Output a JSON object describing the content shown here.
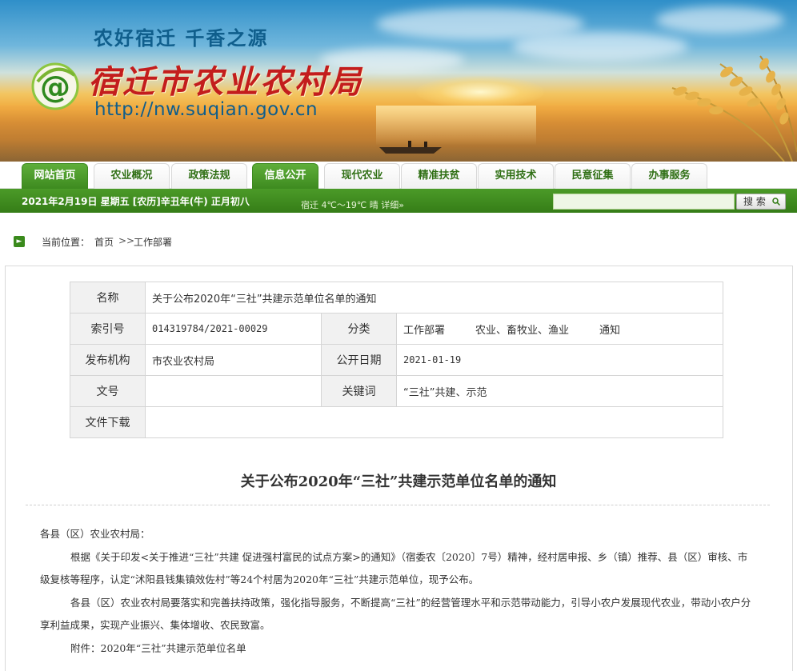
{
  "header": {
    "slogan": "农好宿迁  千香之源",
    "org_name": "宿迁市农业农村局",
    "site_url": "http://nw.suqian.gov.cn",
    "logo_text": "@"
  },
  "nav": {
    "tabs": [
      {
        "label": "网站首页",
        "active": true
      },
      {
        "label": "农业概况",
        "active": false
      },
      {
        "label": "政策法规",
        "active": false
      },
      {
        "label": "信息公开",
        "active": true
      },
      {
        "label": "现代农业",
        "active": false
      },
      {
        "label": "精准扶贫",
        "active": false
      },
      {
        "label": "实用技术",
        "active": false
      },
      {
        "label": "民意征集",
        "active": false
      },
      {
        "label": "办事服务",
        "active": false
      }
    ]
  },
  "infobar": {
    "date": "2021年2月19日 星期五 [农历]辛丑年(牛) 正月初八",
    "weather": "宿迁 4℃～19℃ 晴 详细»",
    "search_placeholder": "",
    "search_label": "搜 索"
  },
  "breadcrumb": {
    "label": "当前位置：",
    "home": "首页",
    "separator": ">>",
    "current": "工作部署"
  },
  "meta": {
    "name_key": "名称",
    "name_value": "关于公布2020年“三社”共建示范单位名单的通知",
    "index_key": "索引号",
    "index_value": "014319784/2021-00029",
    "category_key": "分类",
    "category_values": [
      "工作部署",
      "农业、畜牧业、渔业",
      "通知"
    ],
    "publisher_key": "发布机构",
    "publisher_value": "市农业农村局",
    "date_key": "公开日期",
    "date_value": "2021-01-19",
    "docno_key": "文号",
    "docno_value": "",
    "keywords_key": "关键词",
    "keywords_value": "“三社”共建、示范",
    "download_key": "文件下载",
    "download_value": ""
  },
  "article": {
    "title": "关于公布2020年“三社”共建示范单位名单的通知",
    "paragraphs": [
      "各县（区）农业农村局：",
      "根据《关于印发<关于推进“三社”共建 促进强村富民的试点方案>的通知》（宿委农〔2020〕7号）精神，经村居申报、乡（镇）推荐、县（区）审核、市级复核等程序，认定“沭阳县钱集镇效佐村”等24个村居为2020年“三社”共建示范单位，现予公布。",
      "各县（区）农业农村局要落实和完善扶持政策，强化指导服务，不断提高“三社”的经营管理水平和示范带动能力，引导小农户发展现代农业，带动小农户分享利益成果，实现产业振兴、集体增收、农民致富。",
      "附件：2020年“三社”共建示范单位名单"
    ]
  },
  "colors": {
    "nav_active": "#3d8a1f",
    "nav_text": "#2f6f14",
    "infobar": "#3f8c1f",
    "org_red": "#c31d1d",
    "slogan_blue": "#0f5e8c"
  }
}
